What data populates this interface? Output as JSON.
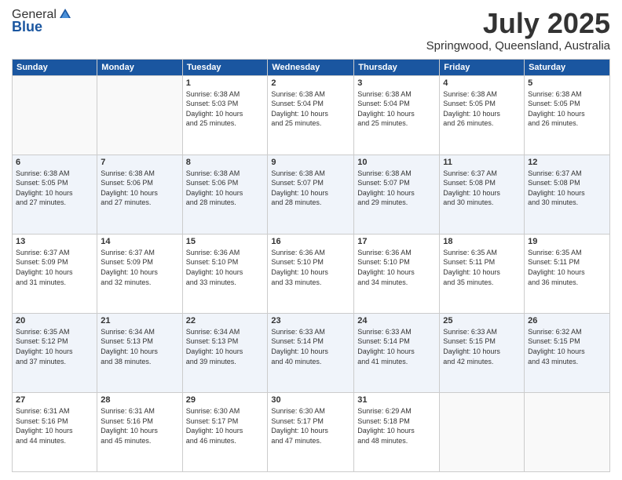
{
  "header": {
    "logo_general": "General",
    "logo_blue": "Blue",
    "month": "July 2025",
    "location": "Springwood, Queensland, Australia"
  },
  "columns": [
    "Sunday",
    "Monday",
    "Tuesday",
    "Wednesday",
    "Thursday",
    "Friday",
    "Saturday"
  ],
  "weeks": [
    [
      {
        "day": "",
        "info": ""
      },
      {
        "day": "",
        "info": ""
      },
      {
        "day": "1",
        "info": "Sunrise: 6:38 AM\nSunset: 5:03 PM\nDaylight: 10 hours\nand 25 minutes."
      },
      {
        "day": "2",
        "info": "Sunrise: 6:38 AM\nSunset: 5:04 PM\nDaylight: 10 hours\nand 25 minutes."
      },
      {
        "day": "3",
        "info": "Sunrise: 6:38 AM\nSunset: 5:04 PM\nDaylight: 10 hours\nand 25 minutes."
      },
      {
        "day": "4",
        "info": "Sunrise: 6:38 AM\nSunset: 5:05 PM\nDaylight: 10 hours\nand 26 minutes."
      },
      {
        "day": "5",
        "info": "Sunrise: 6:38 AM\nSunset: 5:05 PM\nDaylight: 10 hours\nand 26 minutes."
      }
    ],
    [
      {
        "day": "6",
        "info": "Sunrise: 6:38 AM\nSunset: 5:05 PM\nDaylight: 10 hours\nand 27 minutes."
      },
      {
        "day": "7",
        "info": "Sunrise: 6:38 AM\nSunset: 5:06 PM\nDaylight: 10 hours\nand 27 minutes."
      },
      {
        "day": "8",
        "info": "Sunrise: 6:38 AM\nSunset: 5:06 PM\nDaylight: 10 hours\nand 28 minutes."
      },
      {
        "day": "9",
        "info": "Sunrise: 6:38 AM\nSunset: 5:07 PM\nDaylight: 10 hours\nand 28 minutes."
      },
      {
        "day": "10",
        "info": "Sunrise: 6:38 AM\nSunset: 5:07 PM\nDaylight: 10 hours\nand 29 minutes."
      },
      {
        "day": "11",
        "info": "Sunrise: 6:37 AM\nSunset: 5:08 PM\nDaylight: 10 hours\nand 30 minutes."
      },
      {
        "day": "12",
        "info": "Sunrise: 6:37 AM\nSunset: 5:08 PM\nDaylight: 10 hours\nand 30 minutes."
      }
    ],
    [
      {
        "day": "13",
        "info": "Sunrise: 6:37 AM\nSunset: 5:09 PM\nDaylight: 10 hours\nand 31 minutes."
      },
      {
        "day": "14",
        "info": "Sunrise: 6:37 AM\nSunset: 5:09 PM\nDaylight: 10 hours\nand 32 minutes."
      },
      {
        "day": "15",
        "info": "Sunrise: 6:36 AM\nSunset: 5:10 PM\nDaylight: 10 hours\nand 33 minutes."
      },
      {
        "day": "16",
        "info": "Sunrise: 6:36 AM\nSunset: 5:10 PM\nDaylight: 10 hours\nand 33 minutes."
      },
      {
        "day": "17",
        "info": "Sunrise: 6:36 AM\nSunset: 5:10 PM\nDaylight: 10 hours\nand 34 minutes."
      },
      {
        "day": "18",
        "info": "Sunrise: 6:35 AM\nSunset: 5:11 PM\nDaylight: 10 hours\nand 35 minutes."
      },
      {
        "day": "19",
        "info": "Sunrise: 6:35 AM\nSunset: 5:11 PM\nDaylight: 10 hours\nand 36 minutes."
      }
    ],
    [
      {
        "day": "20",
        "info": "Sunrise: 6:35 AM\nSunset: 5:12 PM\nDaylight: 10 hours\nand 37 minutes."
      },
      {
        "day": "21",
        "info": "Sunrise: 6:34 AM\nSunset: 5:13 PM\nDaylight: 10 hours\nand 38 minutes."
      },
      {
        "day": "22",
        "info": "Sunrise: 6:34 AM\nSunset: 5:13 PM\nDaylight: 10 hours\nand 39 minutes."
      },
      {
        "day": "23",
        "info": "Sunrise: 6:33 AM\nSunset: 5:14 PM\nDaylight: 10 hours\nand 40 minutes."
      },
      {
        "day": "24",
        "info": "Sunrise: 6:33 AM\nSunset: 5:14 PM\nDaylight: 10 hours\nand 41 minutes."
      },
      {
        "day": "25",
        "info": "Sunrise: 6:33 AM\nSunset: 5:15 PM\nDaylight: 10 hours\nand 42 minutes."
      },
      {
        "day": "26",
        "info": "Sunrise: 6:32 AM\nSunset: 5:15 PM\nDaylight: 10 hours\nand 43 minutes."
      }
    ],
    [
      {
        "day": "27",
        "info": "Sunrise: 6:31 AM\nSunset: 5:16 PM\nDaylight: 10 hours\nand 44 minutes."
      },
      {
        "day": "28",
        "info": "Sunrise: 6:31 AM\nSunset: 5:16 PM\nDaylight: 10 hours\nand 45 minutes."
      },
      {
        "day": "29",
        "info": "Sunrise: 6:30 AM\nSunset: 5:17 PM\nDaylight: 10 hours\nand 46 minutes."
      },
      {
        "day": "30",
        "info": "Sunrise: 6:30 AM\nSunset: 5:17 PM\nDaylight: 10 hours\nand 47 minutes."
      },
      {
        "day": "31",
        "info": "Sunrise: 6:29 AM\nSunset: 5:18 PM\nDaylight: 10 hours\nand 48 minutes."
      },
      {
        "day": "",
        "info": ""
      },
      {
        "day": "",
        "info": ""
      }
    ]
  ]
}
